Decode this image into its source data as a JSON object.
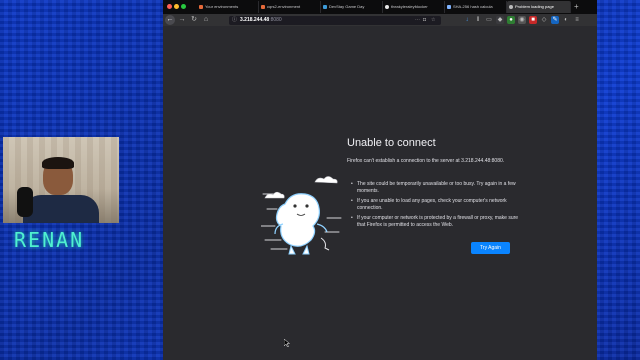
{
  "overlay": {
    "name_label": "RENAN"
  },
  "browser": {
    "tabs": [
      {
        "label": "Your environments",
        "color": "#e66a3a"
      },
      {
        "label": "cqrs2-environment",
        "color": "#e66a3a"
      },
      {
        "label": "DevStay Game Day",
        "color": "#3d9bd9"
      },
      {
        "label": "theakyleraleyfdocker",
        "color": "#e8e8e8"
      },
      {
        "label": "SHA-256 hash calcula",
        "color": "#7fb3ff"
      },
      {
        "label": "Problem loading page",
        "color": "#bbbbbb",
        "active": true
      }
    ],
    "url_host": "3.218.244.48",
    "url_port": ":8080",
    "new_tab_icon": "plus-icon"
  },
  "error_page": {
    "title": "Unable to connect",
    "description": "Firefox can't establish a connection to the server at 3.218.244.48:8080.",
    "bullets": [
      "The site could be temporarily unavailable or too busy. Try again in a few moments.",
      "If you are unable to load any pages, check your computer's network connection.",
      "If your computer or network is protected by a firewall or proxy, make sure that Firefox is permitted to access the Web."
    ],
    "try_again_label": "Try Again",
    "accent_color": "#0a84ff"
  }
}
